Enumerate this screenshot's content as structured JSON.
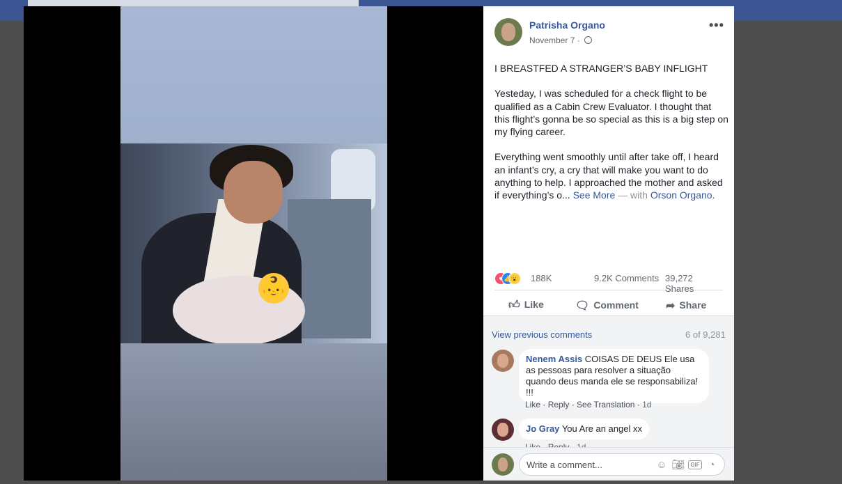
{
  "post": {
    "author": "Patrisha Organo",
    "date": "November 7",
    "date_sep": "·",
    "paragraphs": [
      "I BREASTFED A STRANGER’S BABY INFLIGHT",
      "Yesteday, I was scheduled for a check flight to be qualified as a Cabin Crew Evaluator. I thought that this flight’s gonna be so special as this is a big step on my flying career."
    ],
    "p3_text": "Everything went smoothly until after take off, I heard an infant’s cry, a cry that will make you want to do anything to help. I approached the mother and asked if everything’s o...",
    "see_more": "See More",
    "with_text": "— with",
    "tagged": "Orson Organo."
  },
  "reactions": {
    "icons": [
      "love",
      "like",
      "wow"
    ],
    "count": "188K",
    "comments": "9.2K Comments",
    "shares": "39,272 Shares"
  },
  "actions": {
    "like": "Like",
    "comment": "Comment",
    "share": "Share"
  },
  "comments_section": {
    "view_previous": "View previous comments",
    "count": "6 of 9,281",
    "items": [
      {
        "name": "Nenem Assis",
        "text": "COISAS DE DEUS Ele usa as pessoas para resolver a situação quando deus manda ele se responsabiliza! !!!",
        "like": "Like",
        "reply": "Reply",
        "translate": "See Translation",
        "time": "1d"
      },
      {
        "name": "Jo Gray",
        "text": "You Are an angel xx",
        "like": "Like",
        "reply": "Reply",
        "time": "1d"
      }
    ]
  },
  "composer": {
    "placeholder": "Write a comment...",
    "gif_label": "GIF"
  },
  "media": {
    "emoji": "👶"
  }
}
